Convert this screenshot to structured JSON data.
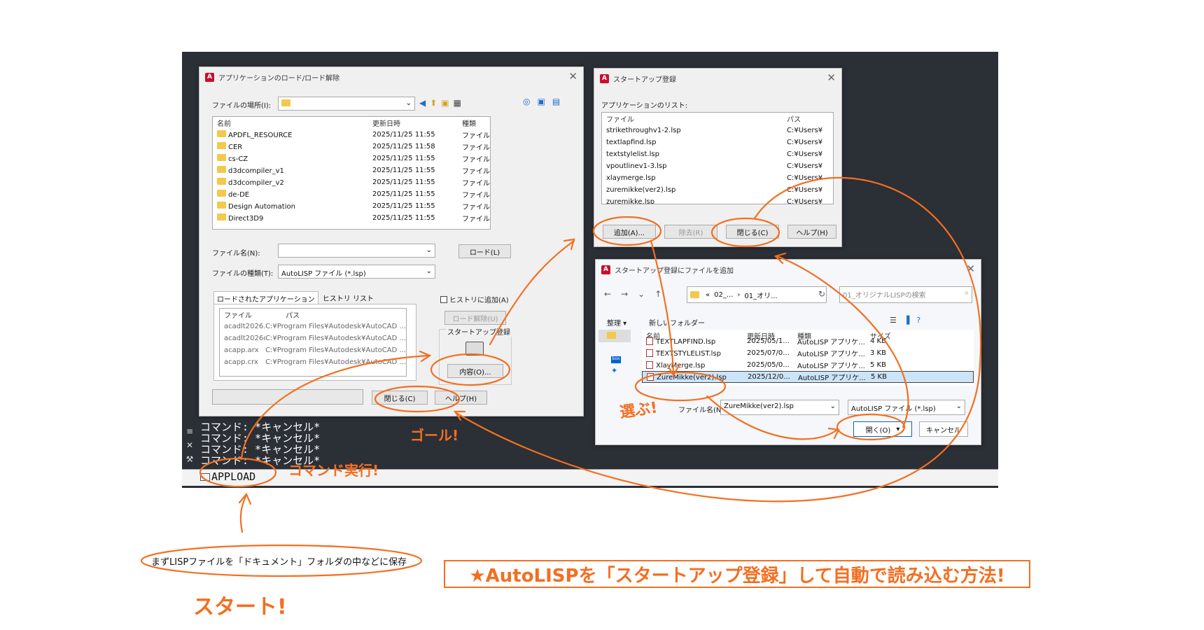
{
  "appload_dialog": {
    "title": "アプリケーションのロード/ロード解除",
    "location_label": "ファイルの場所(I):",
    "columns": [
      "名前",
      "更新日時",
      "種類"
    ],
    "files": [
      {
        "name": "APDFL_RESOURCE",
        "date": "2025/11/25 11:55",
        "type": "ファイル"
      },
      {
        "name": "CER",
        "date": "2025/11/25 11:58",
        "type": "ファイル"
      },
      {
        "name": "cs-CZ",
        "date": "2025/11/25 11:55",
        "type": "ファイル"
      },
      {
        "name": "d3dcompiler_v1",
        "date": "2025/11/25 11:55",
        "type": "ファイル"
      },
      {
        "name": "d3dcompiler_v2",
        "date": "2025/11/25 11:55",
        "type": "ファイル"
      },
      {
        "name": "de-DE",
        "date": "2025/11/25 11:55",
        "type": "ファイル"
      },
      {
        "name": "Design Automation",
        "date": "2025/11/25 11:55",
        "type": "ファイル"
      },
      {
        "name": "Direct3D9",
        "date": "2025/11/25 11:55",
        "type": "ファイル"
      }
    ],
    "filename_label": "ファイル名(N):",
    "load_button": "ロード(L)",
    "filetype_label": "ファイルの種類(T):",
    "filetype_value": "AutoLISP ファイル (*.lsp)",
    "tabs": [
      "ロードされたアプリケーション",
      "ヒストリ リスト"
    ],
    "loaded_columns": [
      "ファイル",
      "パス"
    ],
    "loaded": [
      {
        "file": "acadlt2026.LSP",
        "path": "C:¥Program Files¥Autodesk¥AutoCAD ..."
      },
      {
        "file": "acadlt2026doc...",
        "path": "C:¥Program Files¥Autodesk¥AutoCAD ..."
      },
      {
        "file": "acapp.arx",
        "path": "C:¥Program Files¥Autodesk¥AutoCAD ..."
      },
      {
        "file": "acapp.crx",
        "path": "C:¥Program Files¥Autodesk¥AutoCAD ..."
      }
    ],
    "history_checkbox": "ヒストリに追加(A)",
    "unload_button": "ロード解除(U)",
    "startup_label": "スタートアップ登録",
    "contents_button": "内容(O)...",
    "close_button": "閉じる(C)",
    "help_button": "ヘルプ(H)"
  },
  "startup_dialog": {
    "title": "スタートアップ登録",
    "list_label": "アプリケーションのリスト:",
    "columns": [
      "ファイル",
      "パス"
    ],
    "apps": [
      {
        "file": "strikethroughv1-2.lsp",
        "path": "C:¥Users¥"
      },
      {
        "file": "textlapfind.lsp",
        "path": "C:¥Users¥"
      },
      {
        "file": "textstylelist.lsp",
        "path": "C:¥Users¥"
      },
      {
        "file": "vpoutlinev1-3.lsp",
        "path": "C:¥Users¥"
      },
      {
        "file": "xlaymerge.lsp",
        "path": "C:¥Users¥"
      },
      {
        "file": "zuremikke(ver2).lsp",
        "path": "C:¥Users¥"
      },
      {
        "file": "zuremikke.lsp",
        "path": "C:¥Users¥"
      }
    ],
    "add_button": "追加(A)...",
    "remove_button": "除去(R)",
    "close_button": "閉じる(C)",
    "help_button": "ヘルプ(H)"
  },
  "add_file_dialog": {
    "title": "スタートアップ登録にファイルを追加",
    "path_parts": [
      "«",
      "02_...",
      "›",
      "01_オリ..."
    ],
    "search_placeholder": "01_オリジナルLISPの検索",
    "organize": "整理 ▾",
    "new_folder": "新しいフォルダー",
    "columns": [
      "名前",
      "更新日時",
      "種類",
      "サイズ"
    ],
    "files": [
      {
        "name": "TEXTLAPFIND.lsp",
        "date": "2025/05/1...",
        "type": "AutoLISP アプリケ...",
        "size": "4 KB"
      },
      {
        "name": "TEXTSTYLELIST.lsp",
        "date": "2025/07/0...",
        "type": "AutoLISP アプリケ...",
        "size": "3 KB"
      },
      {
        "name": "XlayMerge.lsp",
        "date": "2025/05/0...",
        "type": "AutoLISP アプリケ...",
        "size": "5 KB"
      },
      {
        "name": "ZureMikke(ver2).lsp",
        "date": "2025/12/0...",
        "type": "AutoLISP アプリケ...",
        "size": "5 KB"
      }
    ],
    "filename_label": "ファイル名(N):",
    "filename_value": "ZureMikke(ver2).lsp",
    "filetype_value": "AutoLISP ファイル (*.lsp)",
    "open_button": "開く(O)",
    "cancel_button": "キャンセル"
  },
  "command": {
    "history": [
      "コマンド: *キャンセル*",
      "コマンド: *キャンセル*",
      "コマンド: *キャンセル*",
      "コマンド: *キャンセル*"
    ],
    "current": "APPLOAD"
  },
  "annotations": {
    "select": "選ぶ!",
    "goal": "ゴール!",
    "run_command": "コマンド実行!",
    "save_note": "まずLISPファイルを「ドキュメント」フォルダの中などに保存",
    "start": "スタート!",
    "headline": "★AutoLISPを「スタートアップ登録」して自動で読み込む方法!"
  },
  "colors": {
    "annotation": "#f36f21",
    "cad_bg": "#2b2f36",
    "dialog_bg": "#f0f0f0",
    "selection": "#cce4f7"
  }
}
